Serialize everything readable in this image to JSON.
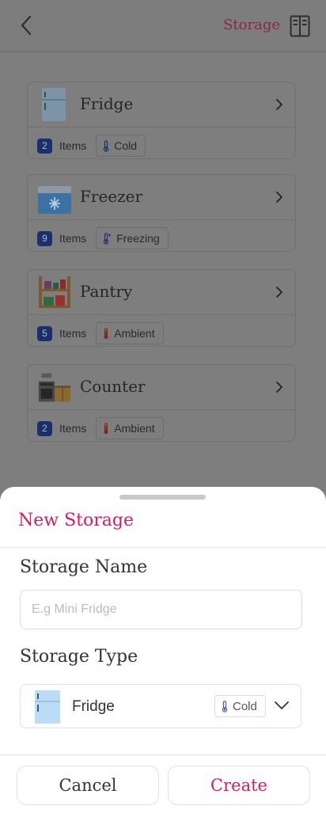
{
  "header": {
    "title": "Storage",
    "back_icon": "chevron-left-icon",
    "action_icon": "storage-cabinet-icon"
  },
  "storages": [
    {
      "name": "Fridge",
      "count": "2",
      "items_label": "Items",
      "temp": "Cold",
      "icon": "fridge-icon"
    },
    {
      "name": "Freezer",
      "count": "9",
      "items_label": "Items",
      "temp": "Freezing",
      "icon": "freezer-icon"
    },
    {
      "name": "Pantry",
      "count": "5",
      "items_label": "Items",
      "temp": "Ambient",
      "icon": "pantry-icon"
    },
    {
      "name": "Counter",
      "count": "2",
      "items_label": "Items",
      "temp": "Ambient",
      "icon": "counter-icon"
    }
  ],
  "sheet": {
    "title": "New Storage",
    "name_label": "Storage Name",
    "name_placeholder": "E.g Mini Fridge",
    "name_value": "",
    "type_label": "Storage Type",
    "type_selected": "Fridge",
    "type_temp": "Cold",
    "cancel_label": "Cancel",
    "create_label": "Create"
  },
  "colors": {
    "accent": "#d81b5f",
    "overlay": "#7e7e7e",
    "count_badge": "#1c2f6d"
  }
}
